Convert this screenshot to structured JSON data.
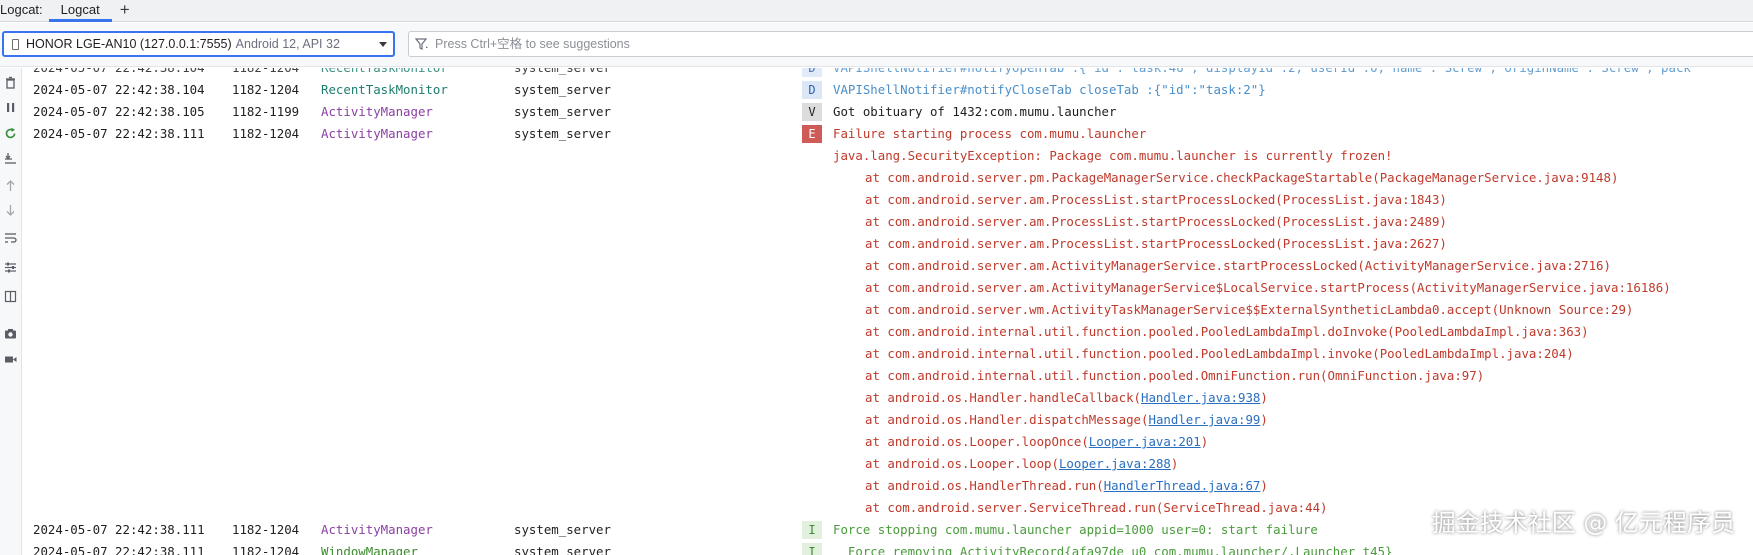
{
  "tabbar": {
    "title": "Logcat:",
    "tab_label": "Logcat",
    "add_label": "+"
  },
  "filterbar": {
    "device_name": "HONOR LGE-AN10 (127.0.0.1:7555)",
    "device_api": "Android 12, API 32",
    "filter_placeholder": "Press Ctrl+空格 to see suggestions"
  },
  "sidebar": {
    "icons": [
      "trash-icon",
      "pause-icon",
      "restart-icon",
      "scroll-to-end-icon",
      "up-arrow-icon",
      "down-arrow-icon",
      "soft-wrap-icon",
      "settings-icon",
      "split-panels-icon",
      "screenshot-icon",
      "screen-record-icon"
    ]
  },
  "log": {
    "rows": [
      {
        "time": "2024-05-07 22:42:38.104",
        "pid": "1182-1204",
        "tag": "RecentTaskMonitor",
        "tag_color": "teal",
        "process": "system_server",
        "level": "D",
        "message": "VAPIShellNotifier#notifyOpenTab :{\"id\":\"task:46\",\"displayId\":2,\"userId\":0,\"name\":\"Screw\",\"originName\":\"Screw\",\"pack"
      },
      {
        "time": "2024-05-07 22:42:38.104",
        "pid": "1182-1204",
        "tag": "RecentTaskMonitor",
        "tag_color": "teal",
        "process": "system_server",
        "level": "D",
        "message": "VAPIShellNotifier#notifyCloseTab closeTab :{\"id\":\"task:2\"}"
      },
      {
        "time": "2024-05-07 22:42:38.105",
        "pid": "1182-1199",
        "tag": "ActivityManager",
        "tag_color": "purple",
        "process": "system_server",
        "level": "V",
        "message": "Got obituary of 1432:com.mumu.launcher"
      },
      {
        "time": "2024-05-07 22:42:38.111",
        "pid": "1182-1204",
        "tag": "ActivityManager",
        "tag_color": "purple",
        "process": "system_server",
        "level": "E",
        "message": "Failure starting process com.mumu.launcher"
      },
      {
        "time": "2024-05-07 22:42:38.111",
        "pid": "1182-1204",
        "tag": "ActivityManager",
        "tag_color": "purple",
        "process": "system_server",
        "level": "I",
        "message": "Force stopping com.mumu.launcher appid=1000 user=0: start failure"
      },
      {
        "time": "2024-05-07 22:42:38.111",
        "pid": "1182-1204",
        "tag": "WindowManager",
        "tag_color": "green",
        "process": "system_server",
        "level": "I",
        "message": "  Force removing ActivityRecord{afa97de u0 com.mumu.launcher/.Launcher t45}"
      }
    ],
    "stack_trace": [
      {
        "text": "java.lang.SecurityException: Package com.mumu.launcher is currently frozen!",
        "link": "",
        "after": ""
      },
      {
        "text": "at com.android.server.pm.PackageManagerService.checkPackageStartable(PackageManagerService.java:9148)",
        "link": "",
        "after": ""
      },
      {
        "text": "at com.android.server.am.ProcessList.startProcessLocked(ProcessList.java:1843)",
        "link": "",
        "after": ""
      },
      {
        "text": "at com.android.server.am.ProcessList.startProcessLocked(ProcessList.java:2489)",
        "link": "",
        "after": ""
      },
      {
        "text": "at com.android.server.am.ProcessList.startProcessLocked(ProcessList.java:2627)",
        "link": "",
        "after": ""
      },
      {
        "text": "at com.android.server.am.ActivityManagerService.startProcessLocked(ActivityManagerService.java:2716)",
        "link": "",
        "after": ""
      },
      {
        "text": "at com.android.server.am.ActivityManagerService$LocalService.startProcess(ActivityManagerService.java:16186)",
        "link": "",
        "after": ""
      },
      {
        "text": "at com.android.server.wm.ActivityTaskManagerService$$ExternalSyntheticLambda0.accept(Unknown Source:29)",
        "link": "",
        "after": ""
      },
      {
        "text": "at com.android.internal.util.function.pooled.PooledLambdaImpl.doInvoke(PooledLambdaImpl.java:363)",
        "link": "",
        "after": ""
      },
      {
        "text": "at com.android.internal.util.function.pooled.PooledLambdaImpl.invoke(PooledLambdaImpl.java:204)",
        "link": "",
        "after": ""
      },
      {
        "text": "at com.android.internal.util.function.pooled.OmniFunction.run(OmniFunction.java:97)",
        "link": "",
        "after": ""
      },
      {
        "text": "at android.os.Handler.handleCallback(",
        "link": "Handler.java:938",
        "after": ")"
      },
      {
        "text": "at android.os.Handler.dispatchMessage(",
        "link": "Handler.java:99",
        "after": ")"
      },
      {
        "text": "at android.os.Looper.loopOnce(",
        "link": "Looper.java:201",
        "after": ")"
      },
      {
        "text": "at android.os.Looper.loop(",
        "link": "Looper.java:288",
        "after": ")"
      },
      {
        "text": "at android.os.HandlerThread.run(",
        "link": "HandlerThread.java:67",
        "after": ")"
      },
      {
        "text": "at com.android.server.ServiceThread.run(ServiceThread.java:44)",
        "link": "",
        "after": ""
      }
    ]
  },
  "watermark": "掘金技术社区 @ 亿元程序员",
  "colors": {
    "accent": "#3874f0",
    "error": "#c0392b",
    "debug": "#4a8ec9",
    "info": "#4a9b3c"
  }
}
